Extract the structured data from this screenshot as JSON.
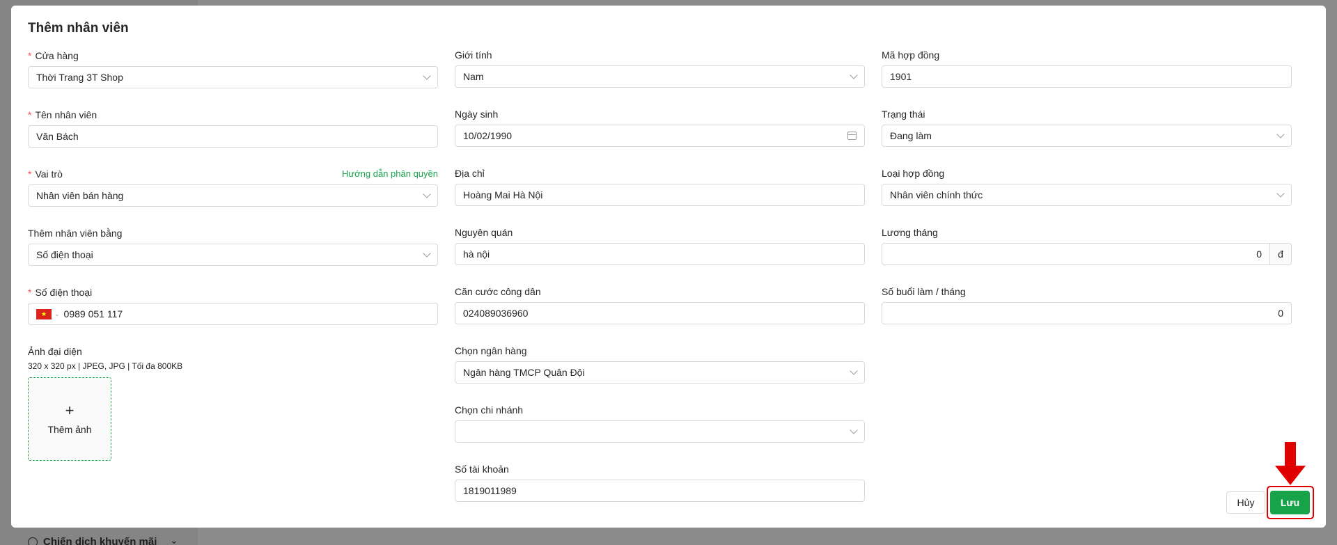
{
  "modal": {
    "title": "Thêm nhân viên",
    "cancel_label": "Hủy",
    "save_label": "Lưu"
  },
  "col1": {
    "store": {
      "label": "Cửa hàng",
      "value": "Thời Trang 3T Shop"
    },
    "name": {
      "label": "Tên nhân viên",
      "value": "Văn Bách"
    },
    "role": {
      "label": "Vai trò",
      "help": "Hướng dẫn phân quyền",
      "value": "Nhân viên bán hàng"
    },
    "add_by": {
      "label": "Thêm nhân viên bằng",
      "value": "Số điện thoại"
    },
    "phone": {
      "label": "Số điện thoại",
      "value": "0989 051 117"
    },
    "avatar": {
      "label": "Ảnh đại diện",
      "hint": "320 x 320 px | JPEG, JPG | Tối đa 800KB",
      "add_label": "Thêm ảnh"
    }
  },
  "col2": {
    "gender": {
      "label": "Giới tính",
      "value": "Nam"
    },
    "dob": {
      "label": "Ngày sinh",
      "value": "10/02/1990"
    },
    "address": {
      "label": "Địa chỉ",
      "value": "Hoàng Mai Hà Nội"
    },
    "hometown": {
      "label": "Nguyên quán",
      "value": "hà nội"
    },
    "citizen_id": {
      "label": "Căn cước công dân",
      "value": "024089036960"
    },
    "bank": {
      "label": "Chọn ngân hàng",
      "value": "Ngân hàng TMCP Quân Đội"
    },
    "branch": {
      "label": "Chọn chi nhánh",
      "value": ""
    },
    "account": {
      "label": "Số tài khoản",
      "value": "1819011989"
    }
  },
  "col3": {
    "contract_code": {
      "label": "Mã hợp đồng",
      "value": "1901"
    },
    "status": {
      "label": "Trạng thái",
      "value": "Đang làm"
    },
    "contract_type": {
      "label": "Loại hợp đồng",
      "value": "Nhân viên chính thức"
    },
    "salary": {
      "label": "Lương tháng",
      "value": "0",
      "unit": "đ"
    },
    "sessions": {
      "label": "Số buổi làm / tháng",
      "value": "0"
    }
  },
  "background": {
    "sidebar_item": "Chiến dịch khuyến mãi"
  },
  "colors": {
    "primary": "#16a34a",
    "required": "#ff4d4f",
    "highlight": "#e00000"
  }
}
